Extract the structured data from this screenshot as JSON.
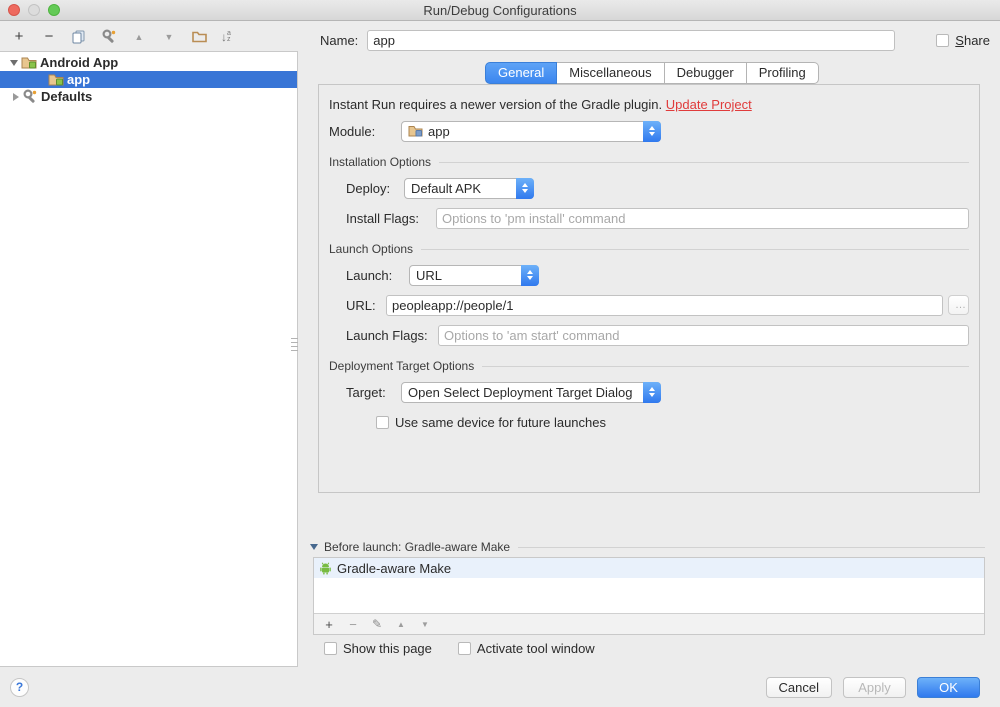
{
  "window": {
    "title": "Run/Debug Configurations"
  },
  "tree": {
    "items": [
      {
        "label": "Android App",
        "expanded": true
      },
      {
        "label": "app",
        "selected": true
      },
      {
        "label": "Defaults",
        "expanded": false
      }
    ]
  },
  "header": {
    "name_label": "Name:",
    "name_value": "app",
    "share_label": "Share"
  },
  "tabs": [
    {
      "label": "General",
      "selected": true
    },
    {
      "label": "Miscellaneous",
      "selected": false
    },
    {
      "label": "Debugger",
      "selected": false
    },
    {
      "label": "Profiling",
      "selected": false
    }
  ],
  "general": {
    "warning_text": "Instant Run requires a newer version of the Gradle plugin. ",
    "warning_link": "Update Project",
    "module_label": "Module:",
    "module_value": "app",
    "installation": {
      "title": "Installation Options",
      "deploy_label": "Deploy:",
      "deploy_value": "Default APK",
      "install_flags_label": "Install Flags:",
      "install_flags_placeholder": "Options to 'pm install' command"
    },
    "launch_options": {
      "title": "Launch Options",
      "launch_label": "Launch:",
      "launch_value": "URL",
      "url_label": "URL:",
      "url_value": "peopleapp://people/1",
      "more_button": "…",
      "launch_flags_label": "Launch Flags:",
      "launch_flags_placeholder": "Options to 'am start' command"
    },
    "deployment": {
      "title": "Deployment Target Options",
      "target_label": "Target:",
      "target_value": "Open Select Deployment Target Dialog",
      "use_same_device_label": "Use same device for future launches"
    }
  },
  "before_launch": {
    "title": "Before launch: Gradle-aware Make",
    "items": [
      {
        "label": "Gradle-aware Make"
      }
    ]
  },
  "footer": {
    "show_this_page": "Show this page",
    "activate_tool_window": "Activate tool window",
    "cancel": "Cancel",
    "apply": "Apply",
    "ok": "OK",
    "help": "?"
  },
  "icons": {
    "add": "+",
    "remove": "−",
    "move_up": "▲",
    "move_down": "▼",
    "sort_arrow": "↓",
    "sort_a": "a",
    "sort_z": "z",
    "edit_pencil": "✎"
  },
  "colors": {
    "selection_blue": "#3875d6",
    "tab_selected_blue": "#3b86ef",
    "ok_button_blue": "#3079ee",
    "link_red": "#e03b3b",
    "android_green": "#8bc34a",
    "folder_tan": "#c49a6c",
    "list_row_highlight": "#e9f1fb"
  }
}
